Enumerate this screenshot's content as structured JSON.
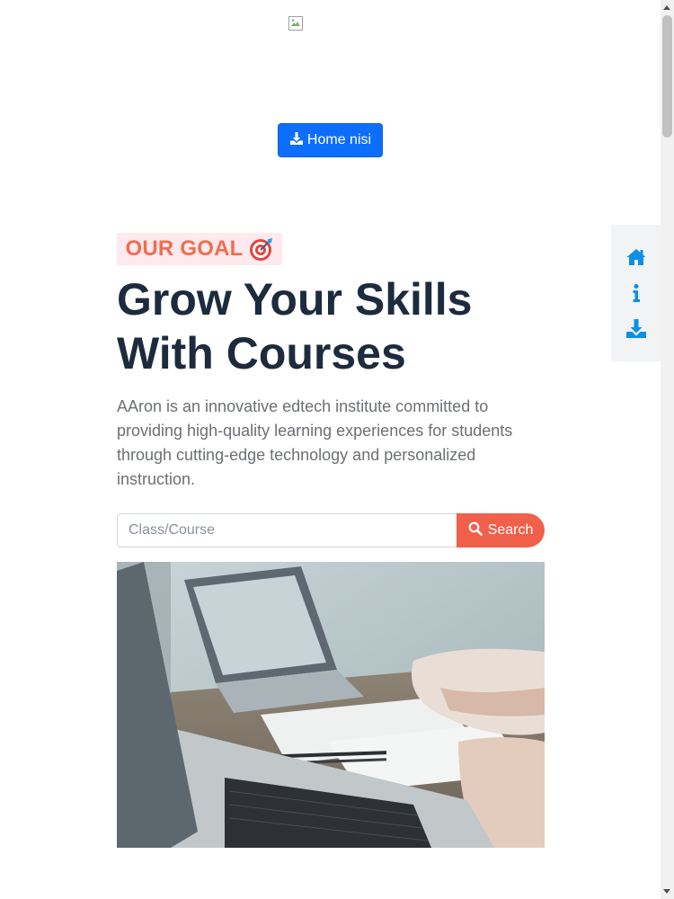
{
  "header": {
    "logo_icon": "broken-image-icon",
    "download_button_label": "Home nisi",
    "download_button_icon": "download-icon"
  },
  "hero": {
    "badge_text": "OUR GOAL",
    "badge_emoji": "🎯",
    "headline": "Grow Your Skills With Courses",
    "description": "AAron is an innovative edtech institute committed to providing high-quality learning experiences for students through cutting-edge technology and personalized instruction.",
    "search": {
      "placeholder": "Class/Course",
      "value": "",
      "button_label": "Search",
      "button_icon": "search-icon"
    },
    "image": "laptops-and-handwritten-notes-photo"
  },
  "side_nav": {
    "items": [
      {
        "icon": "home-icon"
      },
      {
        "icon": "info-icon"
      },
      {
        "icon": "download-icon"
      }
    ]
  },
  "colors": {
    "primary": "#0d6efd",
    "accent": "#f0604a",
    "badge_text": "#ef6e4f",
    "badge_bg": "#fde9ee",
    "heading": "#1c2b3d",
    "nav_icon": "#0d8fe8"
  }
}
